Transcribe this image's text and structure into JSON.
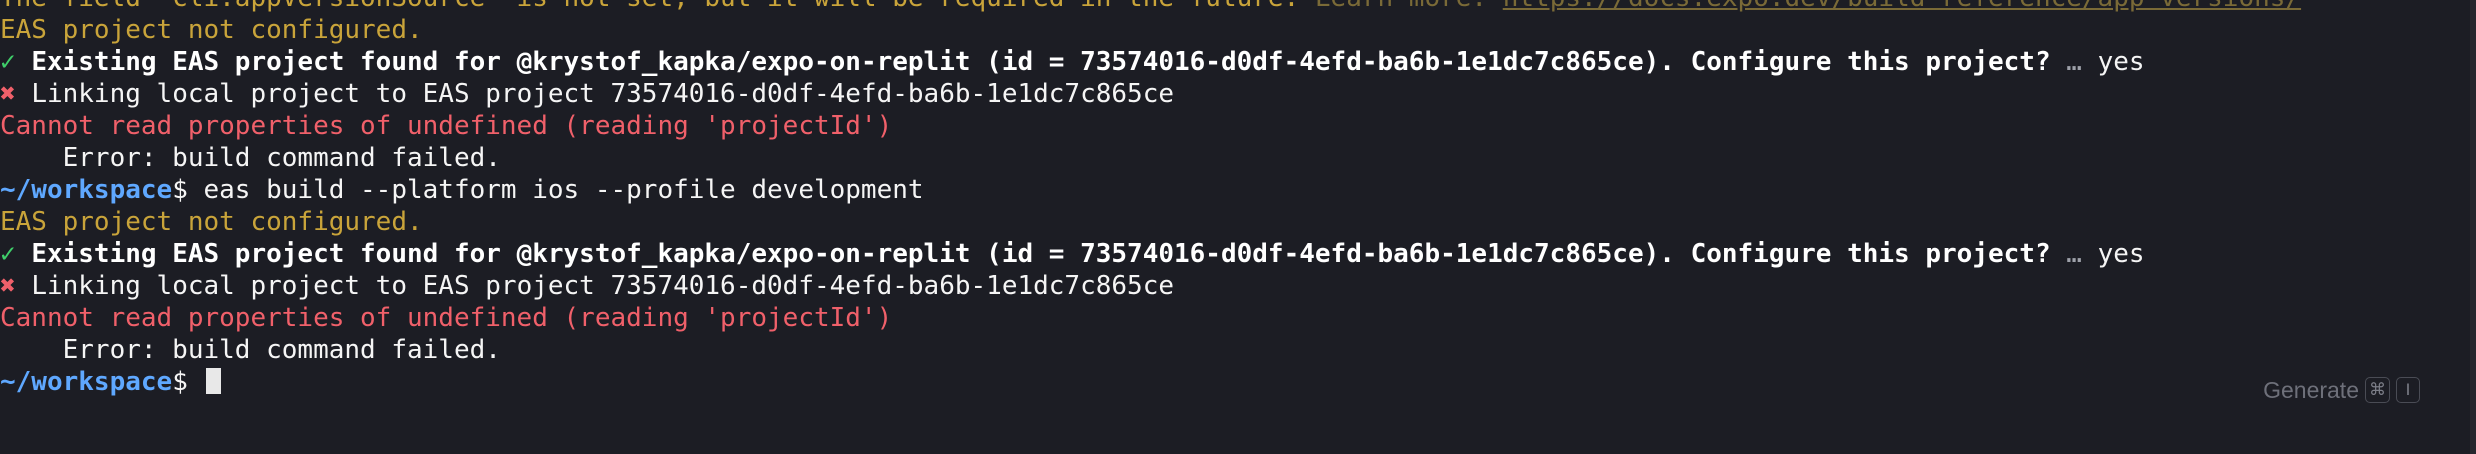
{
  "terminal": {
    "lines": [
      {
        "type": "warning",
        "text": "The field \"cli.appVersionSource\" is not set, but it will be required in the future. ",
        "suffix": "Learn more: ",
        "link": "https://docs.expo.dev/build-reference/app-versions/"
      },
      {
        "type": "warning",
        "text": "EAS project not configured."
      },
      {
        "type": "success",
        "mark": "✓",
        "text": "Existing EAS project found for @krystof_kapka/expo-on-replit (id = 73574016-d0df-4efd-ba6b-1e1dc7c865ce). Configure this project?",
        "ellipsis": " … ",
        "answer": "yes"
      },
      {
        "type": "fail",
        "mark": "✖",
        "text": "Linking local project to EAS project 73574016-d0df-4efd-ba6b-1e1dc7c865ce"
      },
      {
        "type": "error",
        "text": "Cannot read properties of undefined (reading 'projectId')"
      },
      {
        "type": "plain",
        "text": "    Error: build command failed."
      },
      {
        "type": "prompt",
        "path": "~/workspace",
        "symbol": "$",
        "command": " eas build --platform ios --profile development"
      },
      {
        "type": "warning",
        "text": "EAS project not configured."
      },
      {
        "type": "success",
        "mark": "✓",
        "text": "Existing EAS project found for @krystof_kapka/expo-on-replit (id = 73574016-d0df-4efd-ba6b-1e1dc7c865ce). Configure this project?",
        "ellipsis": " … ",
        "answer": "yes"
      },
      {
        "type": "fail",
        "mark": "✖",
        "text": "Linking local project to EAS project 73574016-d0df-4efd-ba6b-1e1dc7c865ce"
      },
      {
        "type": "error",
        "text": "Cannot read properties of undefined (reading 'projectId')"
      },
      {
        "type": "plain",
        "text": "    Error: build command failed."
      },
      {
        "type": "prompt",
        "path": "~/workspace",
        "symbol": "$",
        "command": " "
      }
    ]
  },
  "generate": {
    "label": "Generate",
    "key_cmd": "⌘",
    "key_i": "I"
  },
  "colors": {
    "background": "#1c1d24",
    "warning": "#c9a43a",
    "error": "#f0606a",
    "success": "#3fcf6a",
    "prompt": "#5fa8ff"
  }
}
